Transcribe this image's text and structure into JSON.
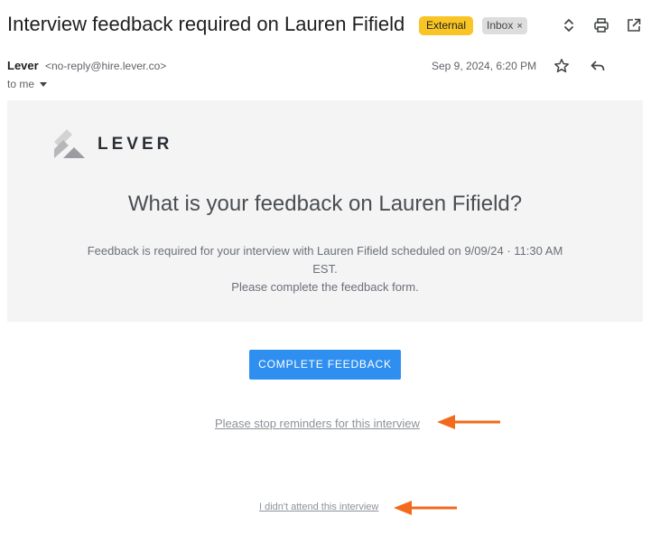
{
  "email": {
    "subject": "Interview feedback required on Lauren Fifield",
    "labels": {
      "external": "External",
      "inbox": "Inbox",
      "inbox_remove": "×"
    },
    "sender": {
      "name": "Lever",
      "email": "<no-reply@hire.lever.co>"
    },
    "recipient": "to me",
    "date": "Sep 9, 2024, 6:20 PM"
  },
  "icons": {
    "top": [
      "expand-collapse-icon",
      "print-icon",
      "open-in-new-window-icon"
    ],
    "header": [
      "star-icon",
      "reply-icon"
    ]
  },
  "content": {
    "logo_text": "LEVER",
    "question": "What is your feedback on Lauren Fifield?",
    "body_line1": "Feedback is required for your interview with Lauren Fifield scheduled on 9/09/24 · 11:30 AM",
    "body_line2": "EST.",
    "body_line3": "Please complete the feedback form.",
    "cta_label": "COMPLETE FEEDBACK",
    "stop_reminders_link": "Please stop reminders for this interview",
    "not_attend_link": "I didn't attend this interview"
  },
  "colors": {
    "external_badge": "#f9c524",
    "cta_button": "#2f8ff0",
    "annotation_arrow": "#f26a1b",
    "panel_background": "#f4f4f4"
  }
}
